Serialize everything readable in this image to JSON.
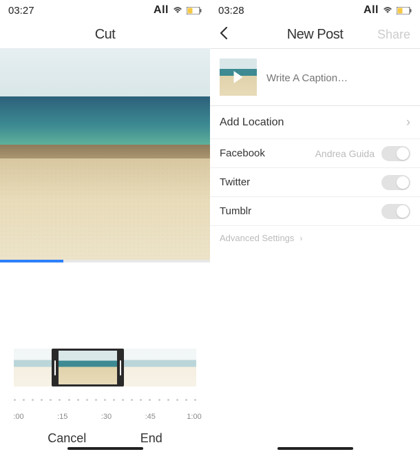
{
  "left": {
    "status": {
      "time": "03:27",
      "network": "All"
    },
    "title": "Cut",
    "timeline": {
      "ticks": [
        ":00",
        ":15",
        ":30",
        ":45",
        "1:00"
      ]
    },
    "buttons": {
      "cancel": "Cancel",
      "end": "End"
    }
  },
  "right": {
    "status": {
      "time": "03:28",
      "network": "All"
    },
    "title": "New Post",
    "share": "Share",
    "caption_placeholder": "Write A Caption…",
    "rows": {
      "location": "Add Location",
      "facebook": {
        "label": "Facebook",
        "account": "Andrea Guida"
      },
      "twitter": "Twitter",
      "tumblr": "Tumblr"
    },
    "advanced": "Advanced Settings"
  }
}
